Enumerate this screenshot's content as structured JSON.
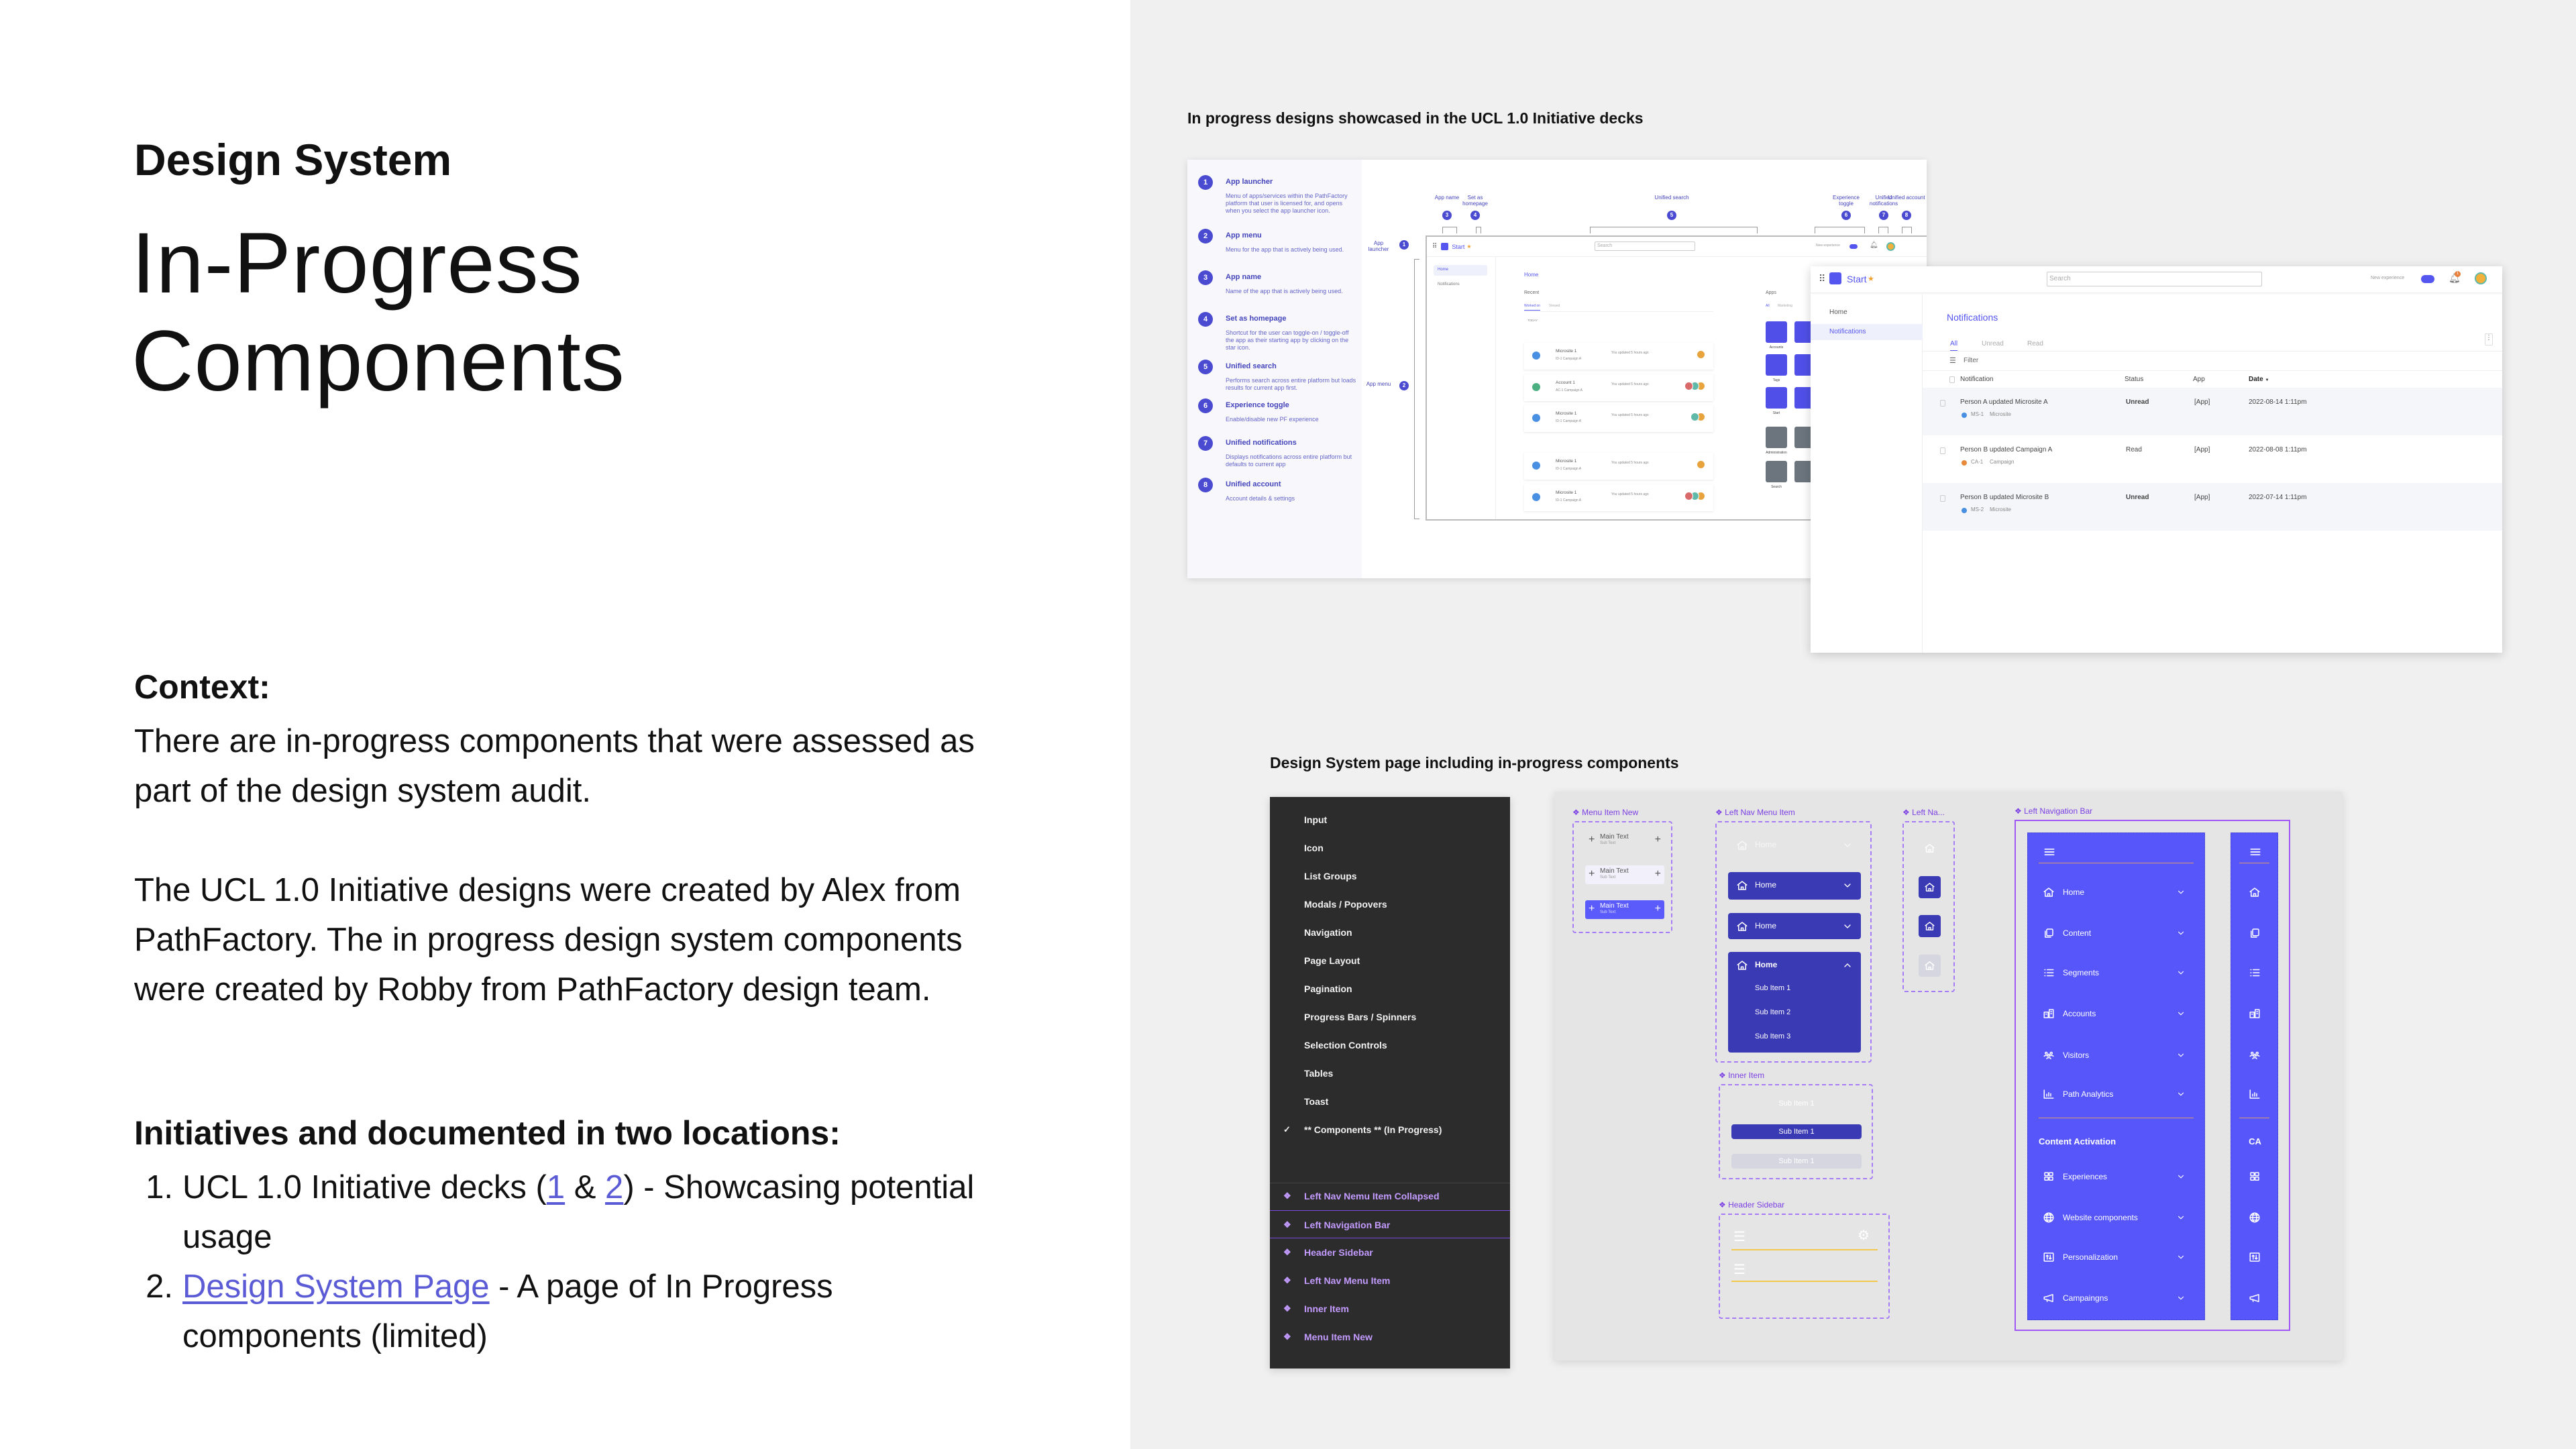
{
  "left": {
    "eyebrow": "Design System",
    "title_line1": "In-Progress",
    "title_line2": "Components",
    "context_heading": "Context:",
    "context_p1": "There are in-progress components that were assessed as part of the design system audit.",
    "context_p2": "The UCL 1.0 Initiative designs were created by Alex from PathFactory. The in progress design system components were created by Robby from PathFactory design team.",
    "locations_heading": "Initiatives and documented in two locations:",
    "item1": {
      "num": "1.",
      "before": "UCL 1.0 Initiative decks (",
      "link1": "1",
      "amp": " & ",
      "link2": "2",
      "after": ") - Showcasing potential usage"
    },
    "item2": {
      "num": "2.",
      "link": "Design System Page",
      "after": " - A page of In Progress components (limited)"
    },
    "link_color": "#5b5bd6"
  },
  "showcase": {
    "caption": "In progress designs showcased in the UCL 1.0 Initiative decks",
    "annotations": [
      {
        "num": "1",
        "title": "App launcher",
        "desc": "Menu of apps/services within the PathFactory platform that user is licensed for, and opens when you select the app launcher icon."
      },
      {
        "num": "2",
        "title": "App menu",
        "desc": "Menu for the app that is actively being used."
      },
      {
        "num": "3",
        "title": "App name",
        "desc": "Name of the app that is actively being used."
      },
      {
        "num": "4",
        "title": "Set as homepage",
        "desc": "Shortcut for the user can toggle-on / toggle-off the app as their starting app by clicking on the star icon."
      },
      {
        "num": "5",
        "title": "Unified search",
        "desc": "Performs search across entire platform but loads results for current app first."
      },
      {
        "num": "6",
        "title": "Experience toggle",
        "desc": "Enable/disable new PF experience"
      },
      {
        "num": "7",
        "title": "Unified notifications",
        "desc": "Displays notifications across entire platform but defaults to current app"
      },
      {
        "num": "8",
        "title": "Unified account",
        "desc": "Account details & settings"
      }
    ],
    "callouts": {
      "app_launcher": "App launcher",
      "app_menu": "App menu",
      "app_name": "App name",
      "set_homepage": "Set as homepage",
      "unified_search": "Unified search",
      "experience_toggle": "Experience toggle",
      "unified_notifications": "Unified notifications",
      "unified_account": "Unified account"
    },
    "app": {
      "name": "Start",
      "search_placeholder": "Search",
      "new_experience": "New experience",
      "notification_count": "1",
      "sidebar": [
        "Home",
        "Notifications"
      ],
      "page_title": "Home",
      "recent": "Recent",
      "tabs": [
        "Worked on",
        "Viewed"
      ],
      "today": "TODAY",
      "this_month": "THIS MONTH",
      "apps_title": "Apps",
      "apps_tabs": [
        "All",
        "Marketing"
      ],
      "cards": [
        {
          "name": "Microsite 1",
          "sub": "ID-1   Campaign A",
          "updated": "You updated 5 hours ago",
          "avatars": 1,
          "color": "#4a90e2"
        },
        {
          "name": "Account 1",
          "sub": "AC-1   Campaign A",
          "updated": "You updated 5 hours ago",
          "avatars": 3,
          "color": "#4caf82"
        },
        {
          "name": "Microsite 1",
          "sub": "ID-1   Campaign A",
          "updated": "You updated 5 hours ago",
          "avatars": 2,
          "color": "#4a90e2"
        },
        {
          "name": "Microsite 1",
          "sub": "ID-1   Campaign A",
          "updated": "You updated 5 hours ago",
          "avatars": 1,
          "color": "#4a90e2"
        },
        {
          "name": "Microsite 1",
          "sub": "ID-1   Campaign A",
          "updated": "You updated 5 hours ago",
          "avatars": 3,
          "color": "#4a90e2"
        }
      ],
      "app_tiles": [
        {
          "label": "Accounts",
          "color": "#5050e8"
        },
        {
          "label": "Tags",
          "color": "#5050e8"
        },
        {
          "label": "Start",
          "color": "#5050e8"
        },
        {
          "label": "Administration",
          "color": "#6c757d"
        },
        {
          "label": "Search",
          "color": "#6c757d"
        }
      ]
    },
    "notifications": {
      "title": "Notifications",
      "tabs": [
        "All",
        "Unread",
        "Read"
      ],
      "filter": "Filter",
      "columns": [
        "Notification",
        "Status",
        "App",
        "Date"
      ],
      "rows": [
        {
          "text": "Person A updated Microsite A",
          "tag": "MS-1",
          "type": "Microsite",
          "status": "Unread",
          "app": "[App]",
          "date": "2022-08-14 1:11pm",
          "tag_color": "#4a90e2"
        },
        {
          "text": "Person B updated Campaign A",
          "tag": "CA-1",
          "type": "Campaign",
          "status": "Read",
          "app": "[App]",
          "date": "2022-08-08 1:11pm",
          "tag_color": "#e88a3c"
        },
        {
          "text": "Person B updated Microsite B",
          "tag": "MS-2",
          "type": "Microsite",
          "status": "Unread",
          "app": "[App]",
          "date": "2022-07-14 1:11pm",
          "tag_color": "#4a90e2"
        }
      ]
    }
  },
  "design_system": {
    "caption": "Design System page including in-progress components",
    "pages": [
      "Input",
      "Icon",
      "List Groups",
      "Modals / Popovers",
      "Navigation",
      "Page Layout",
      "Pagination",
      "Progress Bars / Spinners",
      "Selection Controls",
      "Tables",
      "Toast",
      "** Components ** (In Progress)"
    ],
    "current_page": "** Components ** (In Progress)",
    "layers": [
      "Left Nav Nemu Item Collapsed",
      "Left Navigation Bar",
      "Header Sidebar",
      "Left Nav Menu Item",
      "Inner Item",
      "Menu Item New"
    ],
    "selected_layer": "Left Navigation Bar",
    "components": {
      "menu_item_new": {
        "label": "Menu Item New",
        "main": "Main Text",
        "sub": "Sub Text"
      },
      "left_nav_menu_item": {
        "label": "Left Nav Menu Item",
        "item": "Home",
        "subs": [
          "Sub Item 1",
          "Sub Item 2",
          "Sub Item 3"
        ]
      },
      "left_nav_collapsed": {
        "label": "Left Na..."
      },
      "inner_item": {
        "label": "Inner Item",
        "item": "Sub Item 1"
      },
      "header_sidebar": {
        "label": "Header Sidebar"
      },
      "left_navigation_bar": {
        "label": "Left Navigation Bar",
        "items": [
          {
            "label": "Home",
            "icon": "home-icon"
          },
          {
            "label": "Content",
            "icon": "content-icon"
          },
          {
            "label": "Segments",
            "icon": "list-icon"
          },
          {
            "label": "Accounts",
            "icon": "building-icon"
          },
          {
            "label": "Visitors",
            "icon": "users-icon"
          },
          {
            "label": "Path Analytics",
            "icon": "chart-icon"
          }
        ],
        "section": "Content Activation",
        "section_short": "CA",
        "section_items": [
          {
            "label": "Experiences",
            "icon": "grid-icon"
          },
          {
            "label": "Website components",
            "icon": "globe-icon"
          },
          {
            "label": "Personalization",
            "icon": "sort-icon"
          },
          {
            "label": "Campaingns",
            "icon": "megaphone-icon"
          }
        ]
      }
    },
    "colors": {
      "nav": "#5656fa",
      "nav_active": "#3b3ab5",
      "component_label": "#7b3fe4",
      "dark_panel": "#2c2c2c"
    }
  }
}
